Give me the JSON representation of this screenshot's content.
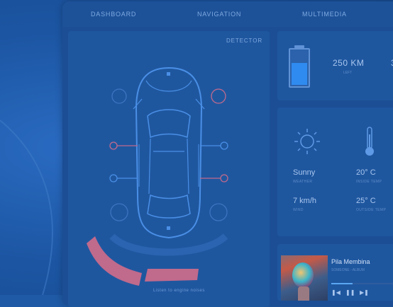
{
  "nav": {
    "tabs": [
      {
        "label": "DASHBOARD"
      },
      {
        "label": "NAVIGATION"
      },
      {
        "label": "MULTIMEDIA"
      }
    ]
  },
  "detector": {
    "title": "DETECTOR",
    "bottom_caption": "Listen to engine noises"
  },
  "battery": {
    "level_fraction": 0.6,
    "distance": "250 KM",
    "distance_label": "LEFT",
    "second_value": "3"
  },
  "weather": {
    "condition": "Sunny",
    "condition_label": "WEATHER",
    "inside_temp": "20° C",
    "inside_label": "INSIDE TEMP",
    "wind": "7 km/h",
    "wind_label": "WIND",
    "outside_temp": "25° C",
    "outside_label": "OUTSIDE TEMP"
  },
  "music": {
    "track": "Pila Membina",
    "artist": "SOMEONE - ALBUM",
    "progress_fraction": 0.3,
    "controls": {
      "prev": "❚◀",
      "play": "❚❚",
      "next": "▶❚"
    }
  },
  "colors": {
    "background": "#1f5aa6",
    "panel": "#1f579f",
    "accent_blue": "#2f8bf0",
    "warning_pink": "#c06a8c"
  }
}
